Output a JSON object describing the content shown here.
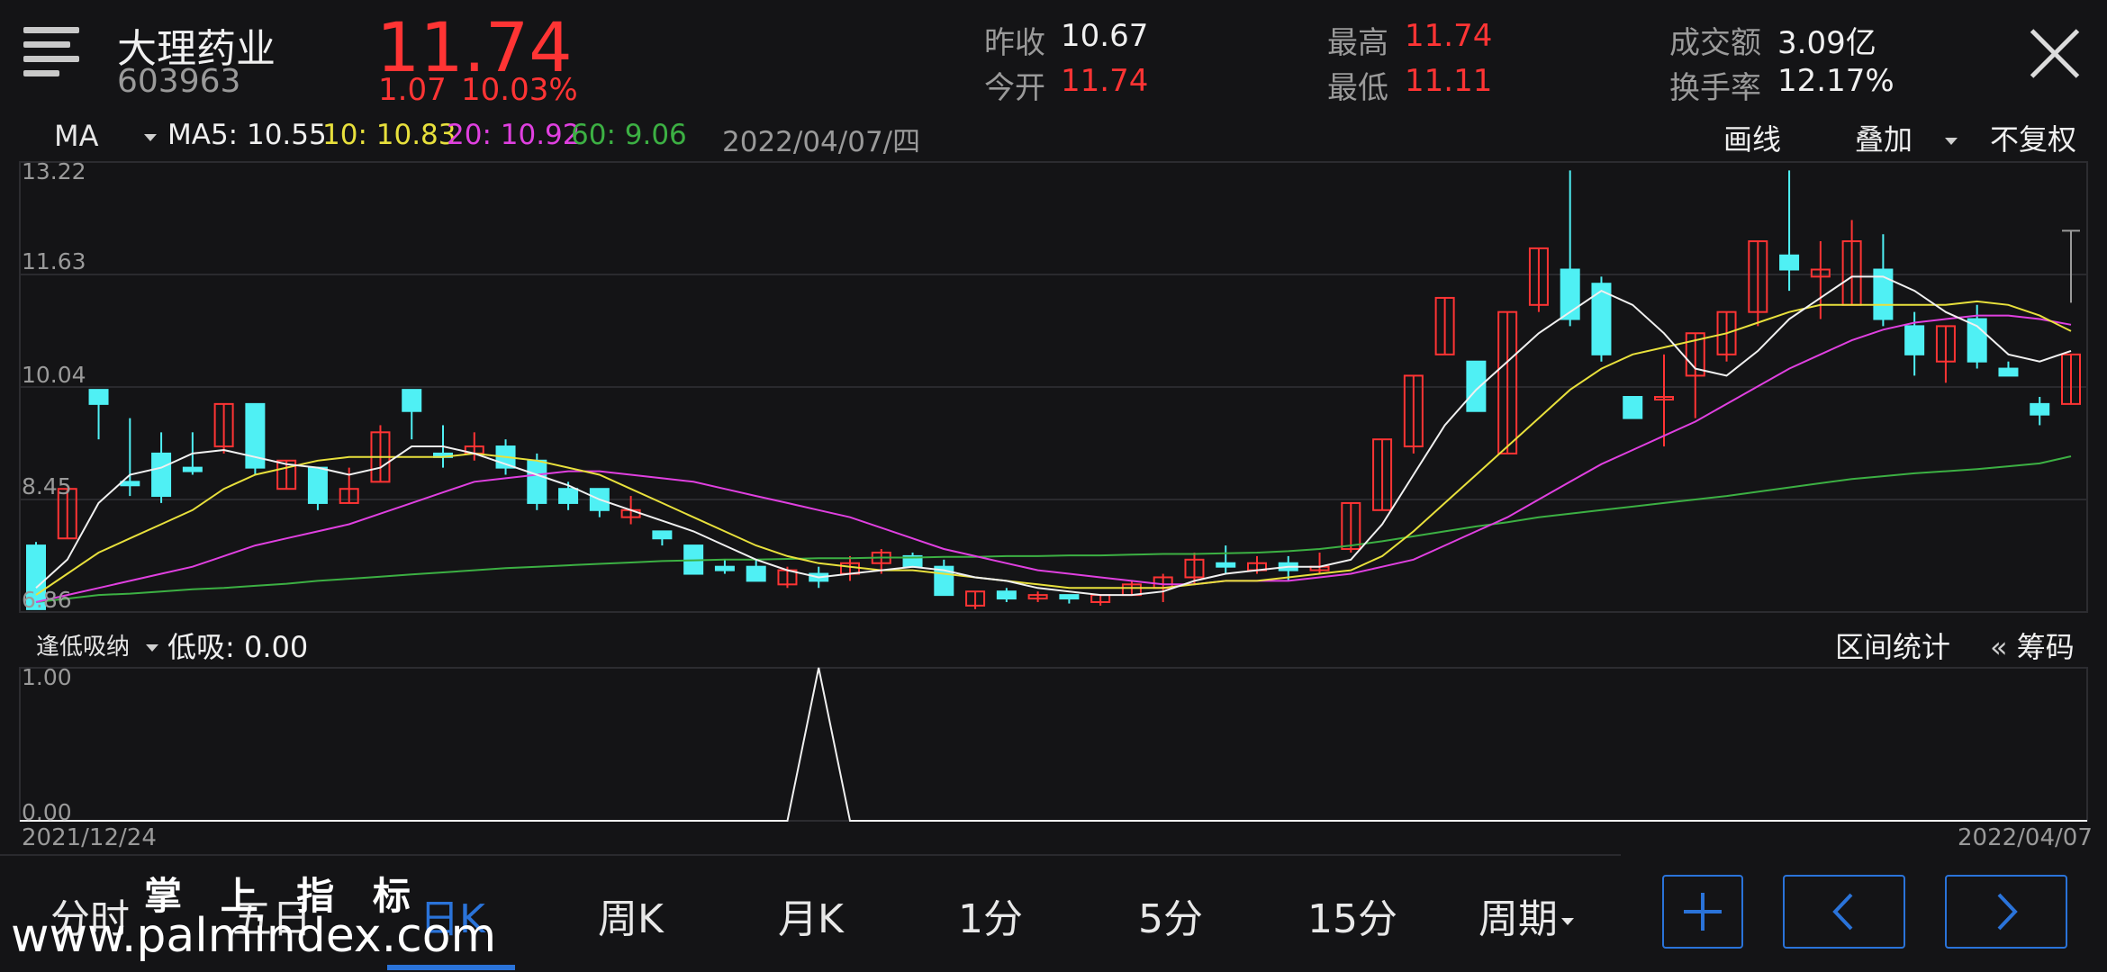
{
  "stock": {
    "name": "大理药业",
    "code": "603963",
    "price": "11.74",
    "change": "1.07",
    "change_pct": "10.03%",
    "prev_close_label": "昨收",
    "prev_close": "10.67",
    "open_label": "今开",
    "open": "11.74",
    "high_label": "最高",
    "high": "11.74",
    "low_label": "最低",
    "low": "11.11",
    "turnover_label": "成交额",
    "turnover": "3.09亿",
    "turnover_rate_label": "换手率",
    "turnover_rate": "12.17%"
  },
  "indicator_bar": {
    "selector": "MA",
    "ma5": "MA5: 10.55",
    "ma10": "10: 10.83",
    "ma20": "20: 10.92",
    "ma60": "60: 9.06",
    "date": "2022/04/07/四",
    "draw_label": "画线",
    "overlay_label": "叠加",
    "adjust_label": "不复权"
  },
  "sub_panel": {
    "selector": "逢低吸纳",
    "value": "低吸: 0.00",
    "range_stats": "区间统计",
    "chips": "筹码",
    "y_top": "1.00",
    "y_bottom": "0.00"
  },
  "dates": {
    "start": "2021/12/24",
    "end": "2022/04/07"
  },
  "tabs": [
    "分时",
    "五日",
    "日K",
    "周K",
    "月K",
    "1分",
    "5分",
    "15分",
    "周期"
  ],
  "active_tab": 2,
  "watermark": {
    "line1": "掌 上 指 标",
    "line2": "www.palmindex.com"
  },
  "colors": {
    "up": "#ff3434",
    "down": "#4ff0f4",
    "ma5": "#f0f0f0",
    "ma10": "#e8e03c",
    "ma20": "#e040e0",
    "ma60": "#3cb043",
    "accent": "#2a73d9"
  },
  "chart_data": {
    "type": "candlestick",
    "y_ticks": [
      "13.22",
      "11.63",
      "10.04",
      "8.45",
      "6.86"
    ],
    "ylim": [
      6.86,
      13.22
    ],
    "candles": [
      [
        7.8,
        6.9,
        7.85,
        6.9
      ],
      [
        7.9,
        8.6,
        8.6,
        7.9
      ],
      [
        10.0,
        9.8,
        10.0,
        9.3
      ],
      [
        8.7,
        8.65,
        9.6,
        8.5
      ],
      [
        9.1,
        8.5,
        9.4,
        8.4
      ],
      [
        8.9,
        8.85,
        9.4,
        8.8
      ],
      [
        9.2,
        9.8,
        9.8,
        9.1
      ],
      [
        9.8,
        8.9,
        9.8,
        8.8
      ],
      [
        8.6,
        9.0,
        9.0,
        8.6
      ],
      [
        8.9,
        8.4,
        8.9,
        8.3
      ],
      [
        8.4,
        8.6,
        8.9,
        8.4
      ],
      [
        8.7,
        9.4,
        9.5,
        8.7
      ],
      [
        10.0,
        9.7,
        10.0,
        9.3
      ],
      [
        9.1,
        9.05,
        9.5,
        8.9
      ],
      [
        9.1,
        9.2,
        9.4,
        9.0
      ],
      [
        9.2,
        8.9,
        9.3,
        8.8
      ],
      [
        9.0,
        8.4,
        9.1,
        8.3
      ],
      [
        8.6,
        8.4,
        8.7,
        8.3
      ],
      [
        8.6,
        8.3,
        8.6,
        8.2
      ],
      [
        8.2,
        8.3,
        8.5,
        8.1
      ],
      [
        8.0,
        7.9,
        8.0,
        7.8
      ],
      [
        7.8,
        7.4,
        7.8,
        7.4
      ],
      [
        7.5,
        7.45,
        7.6,
        7.4
      ],
      [
        7.5,
        7.3,
        7.6,
        7.3
      ],
      [
        7.25,
        7.45,
        7.5,
        7.2
      ],
      [
        7.4,
        7.3,
        7.5,
        7.2
      ],
      [
        7.4,
        7.55,
        7.65,
        7.3
      ],
      [
        7.55,
        7.7,
        7.75,
        7.4
      ],
      [
        7.65,
        7.5,
        7.7,
        7.5
      ],
      [
        7.5,
        7.1,
        7.6,
        7.1
      ],
      [
        6.95,
        7.15,
        7.15,
        6.9
      ],
      [
        7.15,
        7.05,
        7.2,
        7.0
      ],
      [
        7.05,
        7.1,
        7.15,
        7.0
      ],
      [
        7.1,
        7.05,
        7.1,
        6.98
      ],
      [
        7.0,
        7.1,
        7.1,
        6.95
      ],
      [
        7.1,
        7.25,
        7.3,
        7.1
      ],
      [
        7.2,
        7.35,
        7.4,
        7.0
      ],
      [
        7.35,
        7.6,
        7.7,
        7.25
      ],
      [
        7.55,
        7.5,
        7.8,
        7.4
      ],
      [
        7.45,
        7.55,
        7.65,
        7.4
      ],
      [
        7.55,
        7.45,
        7.65,
        7.3
      ],
      [
        7.45,
        7.5,
        7.7,
        7.4
      ],
      [
        7.75,
        8.4,
        8.4,
        7.7
      ],
      [
        8.3,
        9.3,
        9.3,
        8.3
      ],
      [
        9.2,
        10.2,
        10.2,
        9.1
      ],
      [
        10.5,
        11.3,
        11.3,
        10.5
      ],
      [
        10.4,
        9.7,
        10.4,
        9.7
      ],
      [
        9.1,
        11.1,
        11.1,
        9.1
      ],
      [
        11.2,
        12.0,
        12.0,
        11.1
      ],
      [
        11.7,
        11.0,
        13.1,
        10.9
      ],
      [
        11.5,
        10.5,
        11.6,
        10.4
      ],
      [
        9.9,
        9.6,
        9.9,
        9.6
      ],
      [
        9.9,
        9.9,
        10.5,
        9.2
      ],
      [
        10.2,
        10.8,
        10.8,
        9.6
      ],
      [
        10.5,
        11.1,
        11.1,
        10.4
      ],
      [
        11.1,
        12.1,
        12.1,
        10.9
      ],
      [
        11.9,
        11.7,
        13.1,
        11.4
      ],
      [
        11.6,
        11.7,
        12.1,
        11.0
      ],
      [
        11.2,
        12.1,
        12.4,
        11.2
      ],
      [
        11.7,
        11.0,
        12.2,
        10.9
      ],
      [
        10.9,
        10.5,
        11.1,
        10.2
      ],
      [
        10.4,
        10.9,
        10.9,
        10.1
      ],
      [
        11.0,
        10.4,
        11.2,
        10.3
      ],
      [
        10.3,
        10.2,
        10.4,
        10.2
      ],
      [
        9.8,
        9.65,
        9.9,
        9.5
      ],
      [
        9.8,
        10.5,
        10.5,
        9.8
      ]
    ],
    "ma5": [
      7.2,
      7.6,
      8.4,
      8.8,
      8.9,
      9.1,
      9.15,
      9.05,
      8.95,
      8.9,
      8.8,
      8.9,
      9.2,
      9.2,
      9.1,
      8.95,
      8.8,
      8.65,
      8.45,
      8.3,
      8.15,
      8.0,
      7.8,
      7.6,
      7.45,
      7.35,
      7.4,
      7.45,
      7.5,
      7.45,
      7.35,
      7.3,
      7.2,
      7.15,
      7.1,
      7.1,
      7.15,
      7.3,
      7.4,
      7.45,
      7.5,
      7.5,
      7.6,
      8.1,
      8.8,
      9.5,
      10.0,
      10.4,
      10.8,
      11.1,
      11.4,
      11.2,
      10.8,
      10.3,
      10.2,
      10.55,
      11.0,
      11.3,
      11.6,
      11.6,
      11.4,
      11.1,
      10.9,
      10.5,
      10.4,
      10.55
    ],
    "ma10": [
      7.1,
      7.4,
      7.7,
      7.9,
      8.1,
      8.3,
      8.6,
      8.8,
      8.9,
      9.0,
      9.05,
      9.05,
      9.05,
      9.05,
      9.1,
      9.05,
      9.0,
      8.9,
      8.8,
      8.6,
      8.4,
      8.2,
      8.0,
      7.8,
      7.65,
      7.55,
      7.5,
      7.45,
      7.45,
      7.4,
      7.35,
      7.3,
      7.25,
      7.2,
      7.2,
      7.2,
      7.2,
      7.25,
      7.3,
      7.3,
      7.35,
      7.4,
      7.45,
      7.65,
      8.0,
      8.4,
      8.8,
      9.2,
      9.6,
      10.0,
      10.3,
      10.5,
      10.6,
      10.7,
      10.8,
      10.95,
      11.1,
      11.2,
      11.2,
      11.2,
      11.2,
      11.2,
      11.25,
      11.2,
      11.05,
      10.83
    ],
    "ma20": [
      7.0,
      7.1,
      7.2,
      7.3,
      7.4,
      7.5,
      7.65,
      7.8,
      7.9,
      8.0,
      8.1,
      8.25,
      8.4,
      8.55,
      8.7,
      8.75,
      8.8,
      8.85,
      8.85,
      8.8,
      8.75,
      8.7,
      8.6,
      8.5,
      8.4,
      8.3,
      8.2,
      8.05,
      7.9,
      7.75,
      7.65,
      7.55,
      7.45,
      7.4,
      7.35,
      7.3,
      7.25,
      7.25,
      7.3,
      7.3,
      7.3,
      7.35,
      7.4,
      7.5,
      7.6,
      7.8,
      8.0,
      8.2,
      8.45,
      8.7,
      8.95,
      9.15,
      9.35,
      9.55,
      9.8,
      10.05,
      10.3,
      10.5,
      10.7,
      10.85,
      10.95,
      11.0,
      11.05,
      11.05,
      11.0,
      10.92
    ],
    "ma60": [
      7.0,
      7.05,
      7.1,
      7.12,
      7.15,
      7.18,
      7.2,
      7.23,
      7.26,
      7.3,
      7.33,
      7.36,
      7.39,
      7.42,
      7.45,
      7.48,
      7.5,
      7.52,
      7.54,
      7.56,
      7.58,
      7.59,
      7.6,
      7.6,
      7.61,
      7.62,
      7.62,
      7.63,
      7.63,
      7.64,
      7.64,
      7.65,
      7.65,
      7.66,
      7.66,
      7.67,
      7.68,
      7.68,
      7.69,
      7.7,
      7.72,
      7.75,
      7.8,
      7.86,
      7.93,
      8.0,
      8.07,
      8.13,
      8.2,
      8.25,
      8.3,
      8.35,
      8.4,
      8.45,
      8.5,
      8.56,
      8.62,
      8.68,
      8.74,
      8.78,
      8.82,
      8.85,
      8.88,
      8.92,
      8.96,
      9.06
    ],
    "sub_series": {
      "name": "低吸",
      "ylim": [
        0,
        1
      ],
      "values": [
        0,
        0,
        0,
        0,
        0,
        0,
        0,
        0,
        0,
        0,
        0,
        0,
        0,
        0,
        0,
        0,
        0,
        0,
        0,
        0,
        0,
        0,
        0,
        0,
        0,
        1,
        0,
        0,
        0,
        0,
        0,
        0,
        0,
        0,
        0,
        0,
        0,
        0,
        0,
        0,
        0,
        0,
        0,
        0,
        0,
        0,
        0,
        0,
        0,
        0,
        0,
        0,
        0,
        0,
        0,
        0,
        0,
        0,
        0,
        0,
        0,
        0,
        0,
        0,
        0,
        0
      ]
    }
  }
}
